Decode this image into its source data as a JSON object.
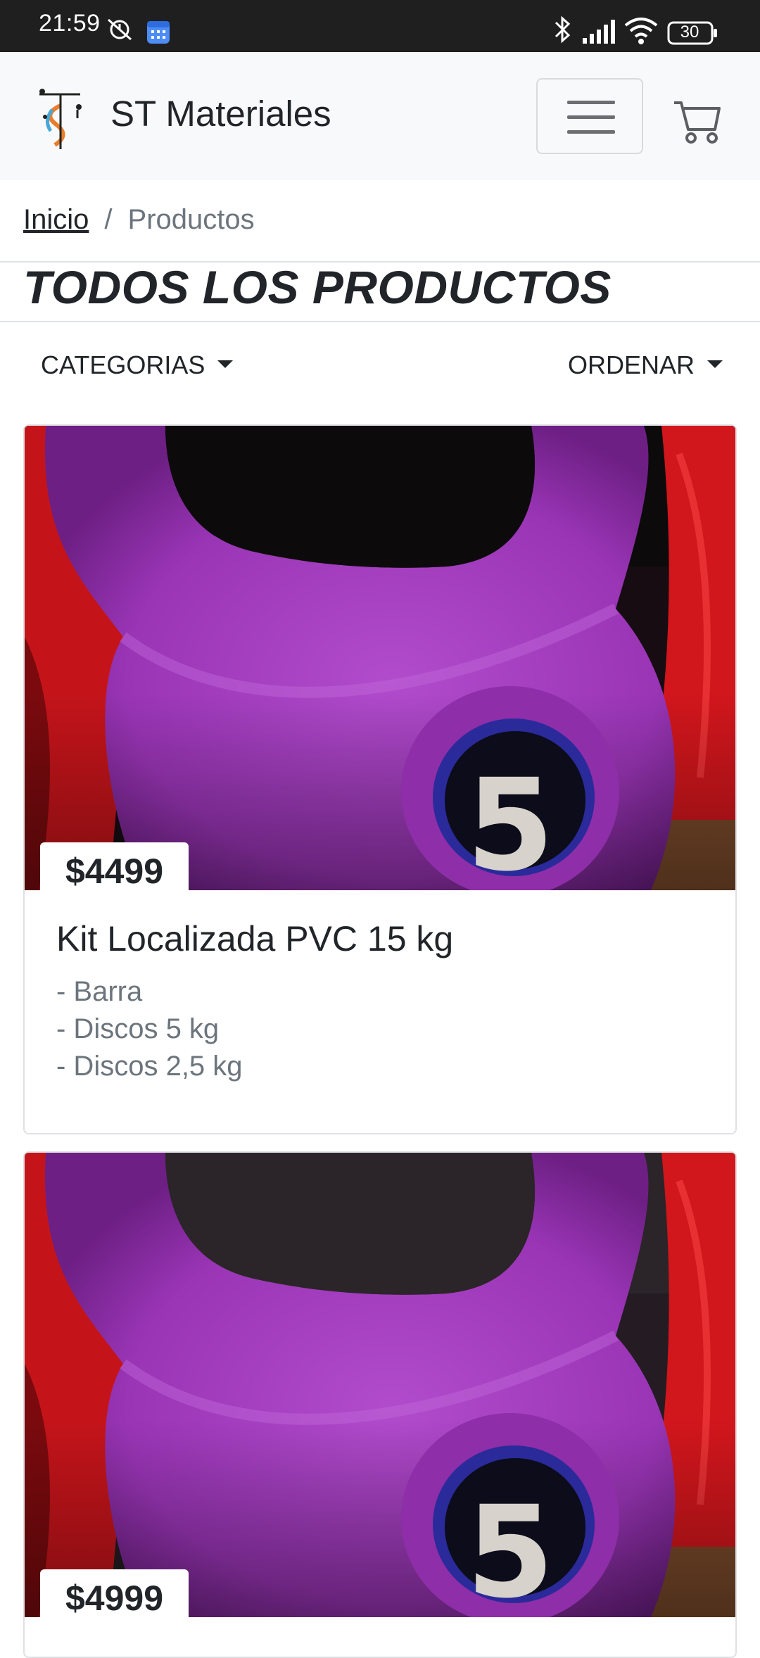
{
  "status_bar": {
    "time": "21:59",
    "battery": "30",
    "icons": [
      "alarm-off-icon",
      "calendar-icon",
      "bluetooth-icon",
      "signal-icon",
      "wifi-icon",
      "battery-icon"
    ]
  },
  "header": {
    "brand": "ST Materiales",
    "logo": "st-materiales-logo",
    "menu_icon": "hamburger-menu-icon",
    "cart_icon": "cart-icon"
  },
  "breadcrumb": {
    "home": "Inicio",
    "separator": "/",
    "current": "Productos"
  },
  "page_title": "TODOS LOS PRODUCTOS",
  "filters": {
    "categories": "CATEGORIAS",
    "sort": "ORDENAR"
  },
  "products": [
    {
      "price": "$4499",
      "name": "Kit Localizada PVC 15 kg",
      "details": [
        "- Barra",
        "- Discos 5 kg",
        "- Discos 2,5 kg"
      ]
    },
    {
      "price": "$4999"
    }
  ],
  "colors": {
    "navbar_bg": "#f8f9fa",
    "kettlebell": "#a53fbf",
    "accent_red": "#d01010",
    "muted_text": "#6c757d"
  }
}
